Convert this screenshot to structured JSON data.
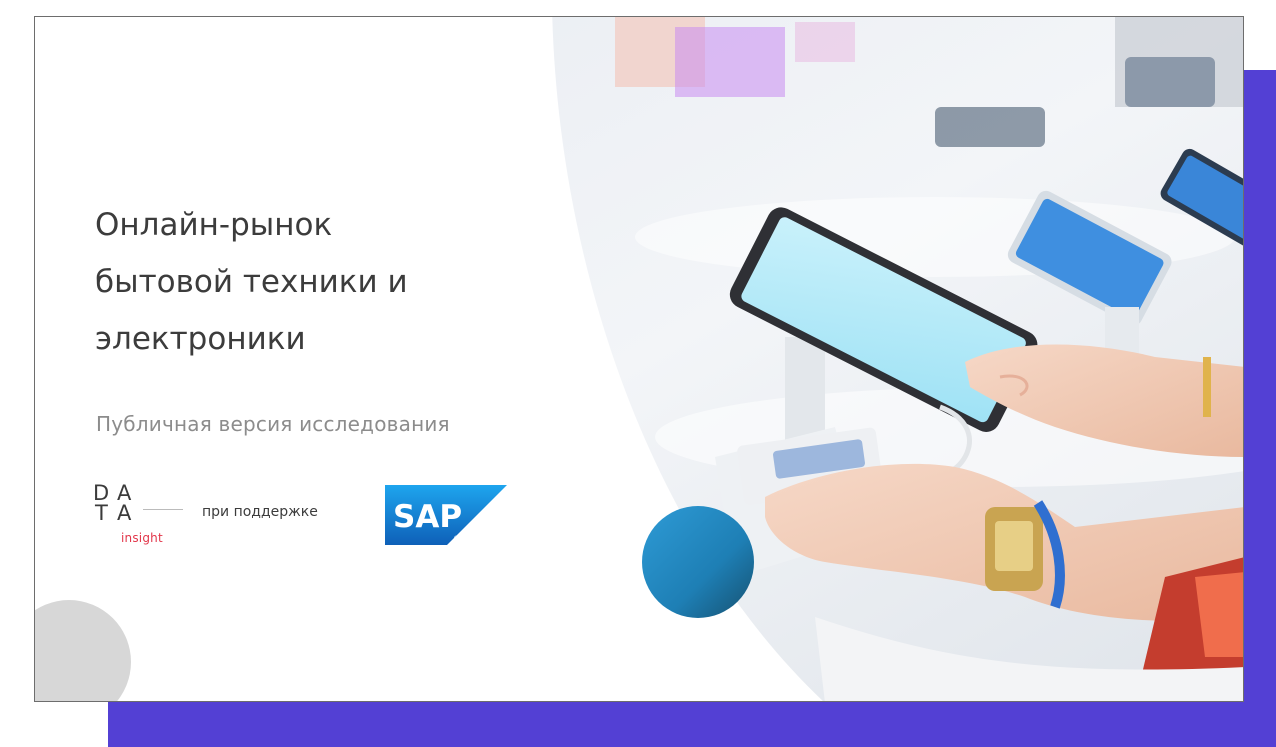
{
  "slide": {
    "title_lines": [
      "Онлайн-рынок",
      "бытовой техники и",
      "электроники"
    ],
    "subtitle": "Публичная версия исследования",
    "support_text": "при поддержке"
  },
  "logos": {
    "data_insight": {
      "letters": [
        "D",
        "A",
        "T",
        "A"
      ],
      "sub": "insight",
      "sub_color": "#e2364a"
    },
    "sap": {
      "text": "SAP",
      "mark": "®",
      "color": "#1a73c8"
    }
  },
  "images": {
    "hero_photo": "hands-using-smartphones-on-store-display-stands"
  },
  "colors": {
    "accent_purple": "#5340d4",
    "teal_circle": "#1d8ccf",
    "title_text": "#3c3c3c",
    "subtitle_text": "#8c8c8c"
  }
}
